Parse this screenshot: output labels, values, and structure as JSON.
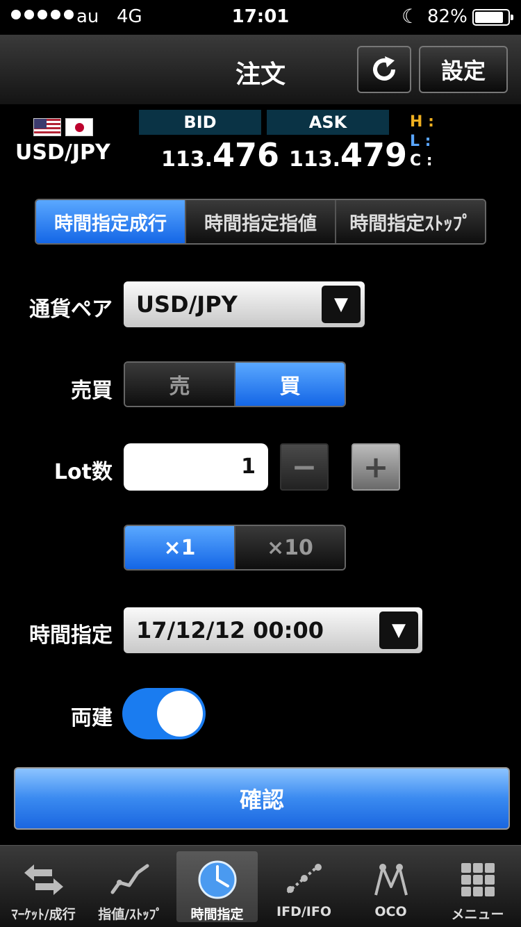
{
  "status": {
    "carrier": "au",
    "network": "4G",
    "time": "17:01",
    "battery": "82%"
  },
  "header": {
    "title": "注文",
    "settings_label": "設定"
  },
  "quote": {
    "pair": "USD/JPY",
    "bid_label": "BID",
    "ask_label": "ASK",
    "bid_small": "113.",
    "bid_big": "476",
    "ask_small": "113.",
    "ask_big": "479",
    "h_label": "H :",
    "l_label": "L :",
    "c_label": "C :"
  },
  "tabs": [
    "時間指定成行",
    "時間指定指値",
    "時間指定ｽﾄｯﾌﾟ"
  ],
  "form": {
    "pair_label": "通貨ペア",
    "pair_value": "USD/JPY",
    "side_label": "売買",
    "sell": "売",
    "buy": "買",
    "lot_label": "Lot数",
    "lot_value": "1",
    "mult_x1": "×1",
    "mult_x10": "×10",
    "time_label": "時間指定",
    "time_value": "17/12/12 00:00",
    "hedge_label": "両建",
    "confirm": "確認"
  },
  "tabbar": [
    "ﾏｰｹｯﾄ/成行",
    "指値/ｽﾄｯﾌﾟ",
    "時間指定",
    "IFD/IFO",
    "OCO",
    "メニュー"
  ],
  "colors": {
    "accent": "#1466e6",
    "bid_header": "#0a3345",
    "high": "#f0b020",
    "low": "#5aa6ff"
  }
}
